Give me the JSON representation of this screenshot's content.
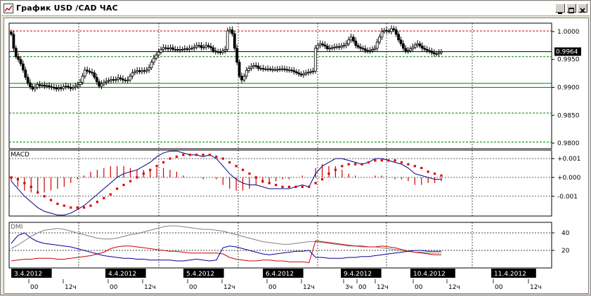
{
  "window": {
    "title": "График USD /CAD ЧАС",
    "minimize_glyph": "_",
    "maximize_glyph": "□",
    "close_glyph": "×",
    "icon": "chart-window-icon"
  },
  "colors": {
    "bg": "#ffffff",
    "grid": "#000000",
    "candle": "#000000",
    "macd_hist": "#cc0000",
    "macd_line": "#000080",
    "signal": "#dd0000",
    "dmi_adx": "#808080",
    "dmi_plus": "#cc0000",
    "dmi_minus": "#000099",
    "level_green": "#008000",
    "level_red": "#cc0000",
    "price_line": "#000000"
  },
  "chart_data": [
    {
      "type": "candlestick",
      "name": "",
      "y_ticks": [
        "1.0000",
        "0.9950",
        "0.9900",
        "0.9850",
        "0.9800"
      ],
      "ylim": [
        0.979,
        1.0015
      ],
      "current_price": "0.9964",
      "levels": [
        {
          "value": 1.0001,
          "color": "red",
          "style": "dashed"
        },
        {
          "value": 0.9955,
          "color": "green",
          "style": "dashed"
        },
        {
          "value": 0.9907,
          "color": "green",
          "style": "solid"
        },
        {
          "value": 0.99,
          "color": "green",
          "style": "solid"
        },
        {
          "value": 0.9854,
          "color": "green",
          "style": "dashed"
        },
        {
          "value": 0.9802,
          "color": "green",
          "style": "dashed"
        }
      ],
      "closes": [
        0.9995,
        0.997,
        0.9955,
        0.995,
        0.9942,
        0.9931,
        0.9918,
        0.9908,
        0.9901,
        0.9897,
        0.99,
        0.9905,
        0.9903,
        0.9904,
        0.9902,
        0.9903,
        0.9901,
        0.99,
        0.9899,
        0.9897,
        0.9899,
        0.9898,
        0.9901,
        0.9902,
        0.99,
        0.9898,
        0.99,
        0.9902,
        0.9905,
        0.9909,
        0.992,
        0.9931,
        0.9929,
        0.9927,
        0.9926,
        0.9918,
        0.991,
        0.9902,
        0.9906,
        0.9909,
        0.9911,
        0.9912,
        0.9914,
        0.9913,
        0.9914,
        0.9917,
        0.9915,
        0.9913,
        0.9912,
        0.9913,
        0.992,
        0.9926,
        0.9928,
        0.993,
        0.9928,
        0.993,
        0.9929,
        0.9931,
        0.9935,
        0.9945,
        0.9952,
        0.9958,
        0.9963,
        0.9968,
        0.9971,
        0.997,
        0.9969,
        0.9971,
        0.9968,
        0.9968,
        0.9967,
        0.9968,
        0.9968,
        0.9969,
        0.9968,
        0.997,
        0.997,
        0.9972,
        0.9975,
        0.9975,
        0.9971,
        0.9972,
        0.9975,
        0.9973,
        0.9971,
        0.9965,
        0.9964,
        0.9963,
        0.9963,
        0.9965,
        0.9968,
        1.0001,
        1.0003,
        0.9996,
        0.997,
        0.9945,
        0.992,
        0.9913,
        0.992,
        0.993,
        0.9934,
        0.9937,
        0.9939,
        0.9938,
        0.9934,
        0.9934,
        0.9933,
        0.9933,
        0.9933,
        0.9932,
        0.9932,
        0.9932,
        0.9932,
        0.9933,
        0.9933,
        0.9932,
        0.9931,
        0.9931,
        0.993,
        0.9928,
        0.9926,
        0.9924,
        0.9922,
        0.9924,
        0.9926,
        0.9927,
        0.9928,
        0.9929,
        0.997,
        0.9975,
        0.9978,
        0.9976,
        0.9974,
        0.9969,
        0.997,
        0.9971,
        0.9972,
        0.9973,
        0.9972,
        0.9974,
        0.9975,
        0.9978,
        0.9985,
        0.999,
        0.9983,
        0.9975,
        0.9972,
        0.997,
        0.9969,
        0.9966,
        0.9965,
        0.9966,
        0.9968,
        0.997,
        0.9981,
        0.999,
        1.0,
        1.0002,
        1.0001,
        1.0,
        1.0005,
        1.0003,
        0.9995,
        0.9985,
        0.9978,
        0.997,
        0.9965,
        0.9966,
        0.9969,
        0.9972,
        0.9976,
        0.9978,
        0.9974,
        0.997,
        0.9968,
        0.9966,
        0.9965,
        0.9962,
        0.996,
        0.996,
        0.9962,
        0.9964
      ]
    },
    {
      "type": "line",
      "name": "MACD",
      "y_ticks": [
        "+0.001",
        "+0.000",
        "-0.001"
      ],
      "ylim": [
        -0.00205,
        0.00145
      ],
      "series": [
        {
          "name": "",
          "role": "macd_line",
          "values": [
            -0.0002,
            -0.0006,
            -0.001,
            -0.0013,
            -0.0016,
            -0.0018,
            -0.0019,
            -0.002,
            -0.002,
            -0.0019,
            -0.0017,
            -0.0015,
            -0.0012,
            -0.0009,
            -0.0006,
            -0.0003,
            0.0,
            0.0002,
            0.0003,
            0.0004,
            0.0006,
            0.0008,
            0.0011,
            0.0013,
            0.0014,
            0.0014,
            0.0013,
            0.0012,
            0.0012,
            0.0011,
            0.0012,
            0.001,
            0.0006,
            0.0002,
            -0.0001,
            -0.0003,
            -0.0004,
            -0.0004,
            -0.0005,
            -0.0006,
            -0.0006,
            -0.0006,
            -0.0006,
            -0.0005,
            -0.0004,
            -0.0005,
            0.0002,
            0.0006,
            0.0008,
            0.001,
            0.001,
            0.0009,
            0.0008,
            0.0007,
            0.0008,
            0.001,
            0.001,
            0.0009,
            0.0008,
            0.0007,
            0.0005,
            0.0002,
            0.0001,
            0.0,
            -0.0001,
            -0.0001
          ]
        },
        {
          "name": "",
          "role": "signal",
          "values": [
            0.0,
            -0.0001,
            -0.0003,
            -0.0005,
            -0.0008,
            -0.001,
            -0.0012,
            -0.0014,
            -0.0015,
            -0.0016,
            -0.0016,
            -0.0016,
            -0.0015,
            -0.0013,
            -0.0011,
            -0.0009,
            -0.0006,
            -0.0004,
            -0.0002,
            0.0,
            0.0002,
            0.0004,
            0.0006,
            0.0008,
            0.001,
            0.0011,
            0.0012,
            0.0012,
            0.0012,
            0.0012,
            0.0012,
            0.0011,
            0.001,
            0.0008,
            0.0006,
            0.0004,
            0.0002,
            0.0,
            -0.0002,
            -0.0003,
            -0.0004,
            -0.0005,
            -0.0005,
            -0.0005,
            -0.0005,
            -0.0005,
            -0.0003,
            -0.0001,
            0.0002,
            0.0004,
            0.0006,
            0.0007,
            0.0007,
            0.0007,
            0.0008,
            0.0009,
            0.0009,
            0.0009,
            0.0009,
            0.0008,
            0.0007,
            0.0006,
            0.0005,
            0.0003,
            0.0002,
            0.0001
          ]
        },
        {
          "name": "",
          "role": "histogram",
          "values": [
            -0.0002,
            -0.0005,
            -0.0007,
            -0.0008,
            -0.0008,
            -0.0008,
            -0.0007,
            -0.0006,
            -0.0005,
            -0.0003,
            -0.0001,
            0.0001,
            0.0003,
            0.0004,
            0.0005,
            0.0006,
            0.0006,
            0.0006,
            0.0005,
            0.0004,
            0.0004,
            0.0004,
            0.0005,
            0.0005,
            0.0004,
            0.0003,
            0.0001,
            0.0,
            0.0,
            -0.0001,
            0.0,
            -0.0001,
            -0.0004,
            -0.0006,
            -0.0007,
            -0.0007,
            -0.0006,
            -0.0004,
            -0.0003,
            -0.0003,
            -0.0002,
            -0.0001,
            -0.0001,
            0.0,
            0.0001,
            0.0,
            0.0005,
            0.0007,
            0.0006,
            0.0006,
            0.0004,
            0.0002,
            0.0001,
            0.0,
            0.0,
            0.0001,
            0.0001,
            0.0,
            -0.0001,
            -0.0001,
            -0.0002,
            -0.0004,
            -0.0004,
            -0.0003,
            -0.0003,
            -0.0002
          ]
        }
      ]
    },
    {
      "type": "line",
      "name": "DMI",
      "y_ticks": [
        "40",
        "20"
      ],
      "ylim": [
        0,
        52
      ],
      "series": [
        {
          "name": "",
          "role": "adx",
          "values": [
            22,
            26,
            31,
            36,
            40,
            43,
            44,
            45,
            44,
            42,
            40,
            38,
            36,
            34,
            33,
            33,
            34,
            36,
            38,
            39,
            41,
            43,
            45,
            47,
            48,
            48,
            47,
            46,
            45,
            44,
            44,
            43,
            42,
            40,
            38,
            36,
            34,
            32,
            30,
            29,
            28,
            27,
            27,
            28,
            29,
            30,
            30,
            29,
            28,
            27,
            26,
            25,
            25,
            24,
            24,
            24,
            23,
            22,
            21,
            20,
            19,
            18,
            18,
            17,
            17,
            17
          ]
        },
        {
          "name": "",
          "role": "plus_di",
          "values": [
            8,
            9,
            10,
            10,
            11,
            11,
            11,
            10,
            10,
            11,
            12,
            13,
            14,
            16,
            18,
            22,
            24,
            25,
            25,
            24,
            23,
            22,
            21,
            20,
            19,
            19,
            18,
            17,
            17,
            17,
            17,
            17,
            16,
            12,
            10,
            9,
            8,
            8,
            9,
            9,
            8,
            8,
            7,
            7,
            7,
            6,
            31,
            30,
            29,
            28,
            27,
            26,
            25,
            25,
            24,
            24,
            25,
            24,
            23,
            21,
            19,
            18,
            17,
            16,
            15,
            15
          ]
        },
        {
          "name": "",
          "role": "minus_di",
          "values": [
            28,
            37,
            40,
            34,
            30,
            28,
            27,
            26,
            25,
            24,
            22,
            20,
            18,
            16,
            14,
            13,
            12,
            11,
            11,
            10,
            10,
            9,
            9,
            9,
            9,
            8,
            8,
            9,
            10,
            9,
            8,
            9,
            23,
            25,
            24,
            22,
            20,
            18,
            16,
            15,
            16,
            17,
            18,
            19,
            19,
            20,
            12,
            12,
            11,
            11,
            11,
            12,
            12,
            13,
            13,
            14,
            15,
            16,
            17,
            18,
            19,
            20,
            20,
            19,
            19,
            19
          ]
        }
      ]
    }
  ],
  "time_axis": {
    "dates": [
      "3.4.2012",
      "4.4.2012",
      "5.4.2012",
      "6.4.2012",
      "9.4.2012",
      "10.4.2012",
      "11.4.2012"
    ],
    "hour_labels": [
      [
        "00",
        "12ч"
      ],
      [
        "00",
        "12ч"
      ],
      [
        "00",
        "12ч"
      ],
      [
        "00",
        "12ч"
      ],
      [
        "3ч",
        "00",
        "12ч"
      ],
      [
        "00",
        "12ч"
      ],
      [
        "00",
        "12ч"
      ]
    ]
  }
}
